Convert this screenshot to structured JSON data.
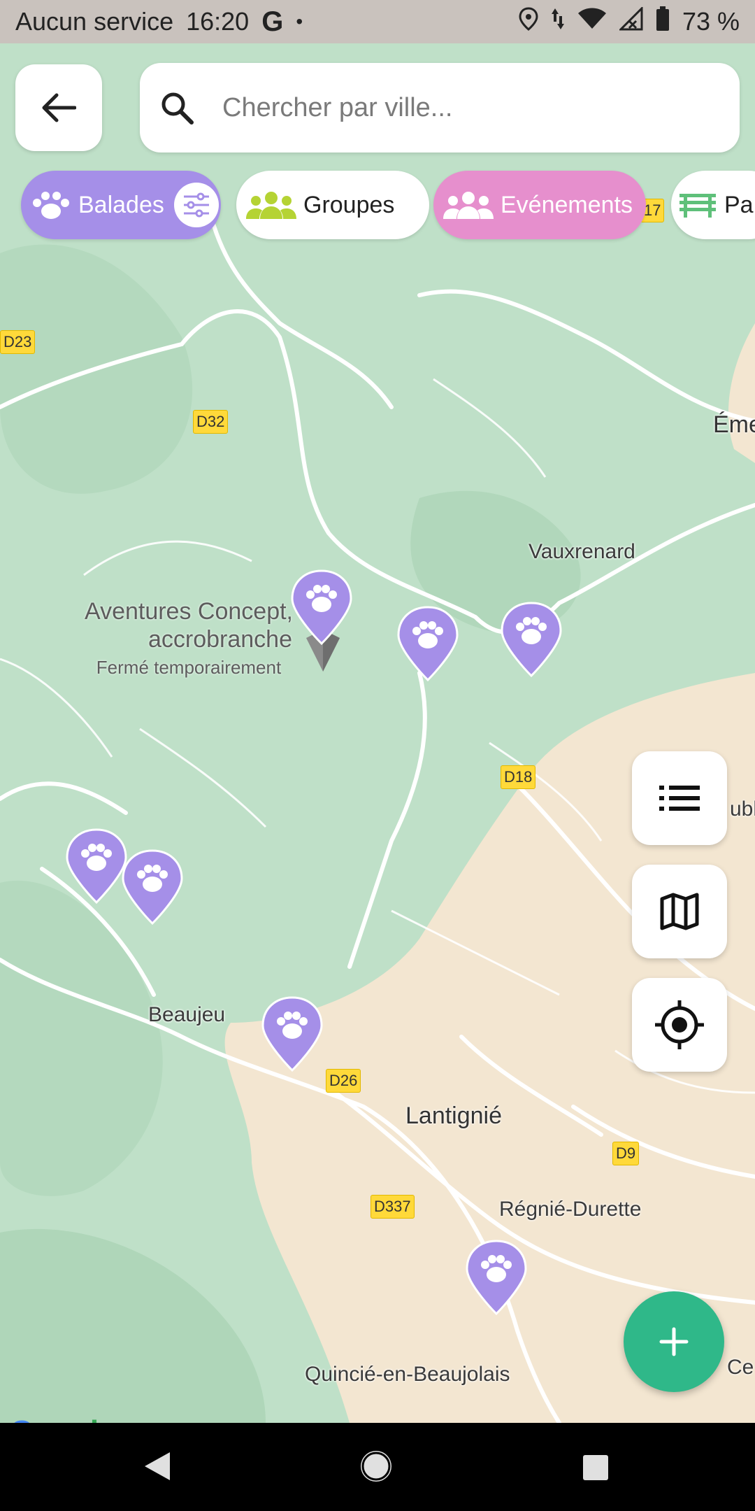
{
  "status_bar": {
    "carrier": "Aucun service",
    "time": "16:20",
    "g_label": "G",
    "dot": "•",
    "battery": "73 %"
  },
  "search": {
    "placeholder": "Chercher par ville..."
  },
  "chips": {
    "balades": "Balades",
    "groupes": "Groupes",
    "evenements": "Evénements",
    "parcs": "Pa"
  },
  "map": {
    "places": {
      "vauxrenard": "Vauxrenard",
      "beaujeu": "Beaujeu",
      "lantignie": "Lantignié",
      "regnie": "Régnié-Durette",
      "quincie": "Quincié-en-Beaujolais",
      "eme": "Éme",
      "ubl": "ubl",
      "ce": "Ce"
    },
    "poi": {
      "name_line1": "Aventures Concept,",
      "name_line2": "accrobranche",
      "status": "Fermé temporairement"
    },
    "roads": {
      "d23": "D23",
      "d32": "D32",
      "d17": "17",
      "d18": "D18",
      "d26": "D26",
      "d9": "D9",
      "d337": "D337"
    },
    "attribution": "Google"
  },
  "colors": {
    "balades": "#a58fe8",
    "evenements": "#e68fcd",
    "groupes_icon": "#b5d334",
    "fab": "#2fb889",
    "marker": "#a58fe8"
  },
  "icons": [
    "back-arrow-icon",
    "search-icon",
    "paw-icon",
    "filter-icon",
    "group-icon",
    "bench-icon",
    "list-icon",
    "map-icon",
    "locate-icon",
    "plus-icon"
  ]
}
